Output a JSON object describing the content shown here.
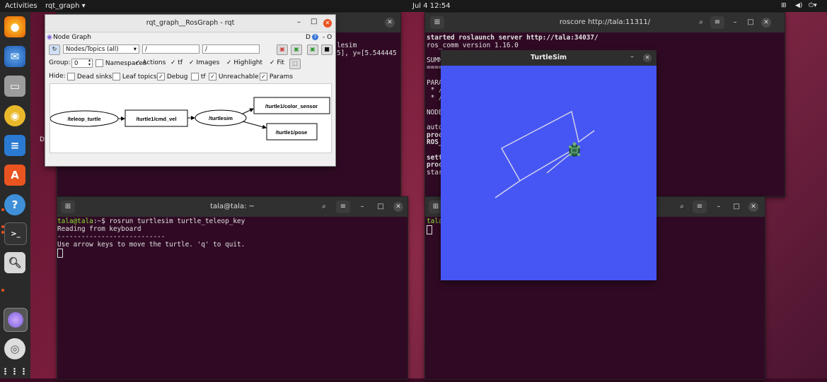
{
  "topbar": {
    "activities": "Activities",
    "app_menu": "rqt_graph ▾",
    "clock": "Jul 4  12:54"
  },
  "dock": {
    "items": [
      "firefox-icon",
      "thunderbird-icon",
      "files-icon",
      "rhythmbox-icon",
      "writer-icon",
      "software-icon",
      "help-icon",
      "terminal-icon",
      "image-viewer-icon",
      "app-icon",
      "disc-icon",
      "apps-grid-icon"
    ]
  },
  "rqt": {
    "title": "rqt_graph__RosGraph - rqt",
    "plugin_label": "Node Graph",
    "plugin_right": "D",
    "plugin_right2": "- O",
    "mode_select": "Nodes/Topics (all)",
    "filter1": "/",
    "filter2": "/",
    "group_label": "Group:",
    "group_value": "0",
    "namespaces": "Namespaces",
    "actions": "Actions",
    "tf": "tf",
    "images": "Images",
    "highlight": "Highlight",
    "fit": "Fit",
    "hide_label": "Hide:",
    "dead_sinks": "Dead sinks",
    "leaf_topics": "Leaf topics",
    "debug": "Debug",
    "tf2": "tf",
    "unreachable": "Unreachable",
    "params": "Params",
    "nodes": {
      "teleop": "/teleop_turtle",
      "cmd_vel": "/turtle1/cmd_vel",
      "turtlesim": "/turtlesim",
      "color_sensor": "/turtle1/color_sensor",
      "pose": "/turtle1/pose"
    }
  },
  "term_top_left": {
    "line1": "lesim",
    "line2": "5], y=[5.544445"
  },
  "term_roscore": {
    "title": "roscore http://tala:11311/",
    "lines": [
      "started roslaunch server http://tala:34037/",
      "ros_comm version 1.16.0",
      "",
      "SUMM",
      "====",
      "",
      "PARA",
      " * /",
      " * /",
      "",
      "NODE",
      "",
      "auto",
      "proc",
      "ROS_",
      "",
      "sett",
      "proc",
      "star"
    ]
  },
  "term_bottom_left": {
    "title": "tala@tala: ~",
    "prompt_user": "tala@tala",
    "prompt_path": ":~$",
    "command": " rosrun turtlesim turtle_teleop_key",
    "out1": "Reading from keyboard",
    "out2": "---------------------------",
    "out3": "Use arrow keys to move the turtle. 'q' to quit."
  },
  "term_bottom_right": {
    "line1": "tala"
  },
  "turtlesim": {
    "title": "TurtleSim",
    "bg_color": "#4656f5"
  },
  "desktop_label": "D"
}
